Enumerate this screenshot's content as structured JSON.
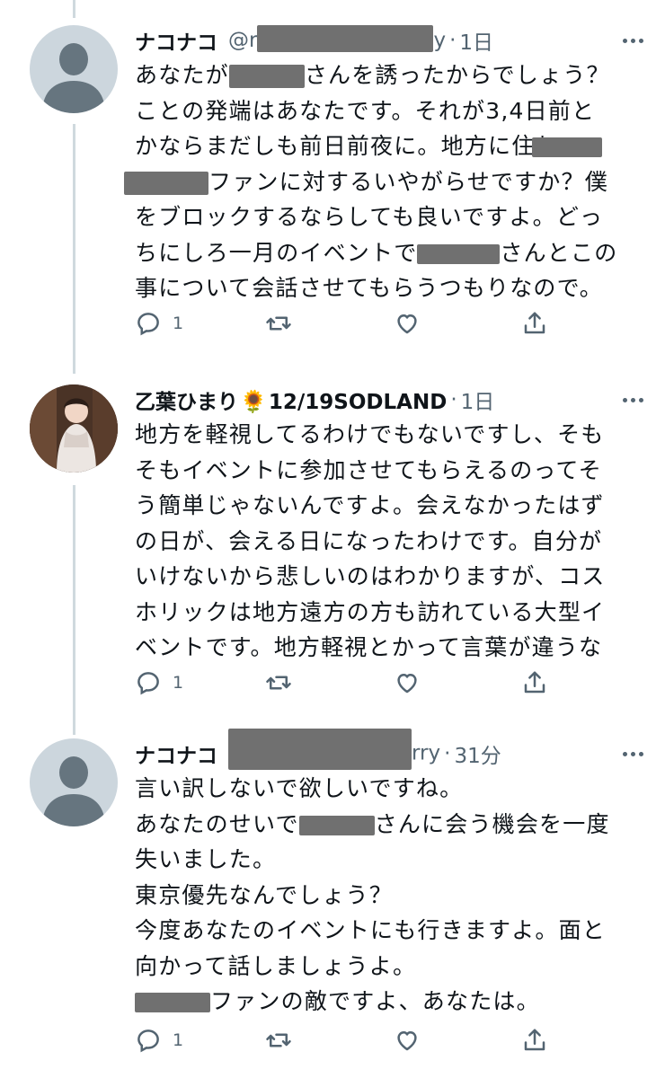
{
  "tweets": [
    {
      "name": "ナコナコ",
      "handle": "@r",
      "handle_tail": "y",
      "time": "1日",
      "lines": [
        [
          "あなたが",
          "",
          "さんを誘ったからでしょう？"
        ],
        [
          "ことの発端はあなたです。それが3,4日前と"
        ],
        [
          "かならまだしも前日前夜に。地方に住む",
          ""
        ],
        [
          "",
          "ファンに対するいやがらせですか？僕"
        ],
        [
          "をブロックするならしても良いですよ。どっ"
        ],
        [
          "ちにしろ一月のイベントで",
          "",
          "さんとこの"
        ],
        [
          "事について会話させてもらうつもりなので。"
        ]
      ],
      "reply_count": "1",
      "retweet_count": "",
      "like_count": ""
    },
    {
      "name": "乙葉ひまり",
      "name_emoji": "🌻",
      "name_suffix": "12/19SODLAND",
      "time": "1日",
      "lines": [
        [
          "地方を軽視してるわけでもないですし、そも"
        ],
        [
          "そもイベントに参加させてもらえるのってそ"
        ],
        [
          "う簡単じゃないんですよ。会えなかったはず"
        ],
        [
          "の日が、会える日になったわけです。自分が"
        ],
        [
          "いけないから悲しいのはわかりますが、コス"
        ],
        [
          "ホリックは地方遠方の方も訪れている大型イ"
        ],
        [
          "ベントです。地方軽視とかって言葉が違うな"
        ]
      ],
      "reply_count": "1",
      "retweet_count": "",
      "like_count": ""
    },
    {
      "name": "ナコナコ",
      "handle": "",
      "handle_tail": "rry",
      "time": "31分",
      "lines": [
        [
          "言い訳しないで欲しいですね。"
        ],
        [
          "あなたのせいで",
          "",
          "さんに会う機会を一度"
        ],
        [
          "失いました。"
        ],
        [
          "東京優先なんでしょう？"
        ],
        [
          "今度あなたのイベントにも行きますよ。面と"
        ],
        [
          "向かって話しましょうよ。"
        ],
        [
          "",
          "ファンの敵ですよ、あなたは。"
        ]
      ],
      "reply_count": "1",
      "retweet_count": "",
      "like_count": ""
    }
  ],
  "icons": {
    "reply": "reply-icon",
    "retweet": "retweet-icon",
    "like": "heart-icon",
    "share": "share-icon",
    "more": "more-icon"
  },
  "colors": {
    "text": "#0f1419",
    "secondary": "#536471",
    "thread_line": "#cfd9de",
    "avatar_bg": "#ccd6dd",
    "redaction": "#707070"
  }
}
